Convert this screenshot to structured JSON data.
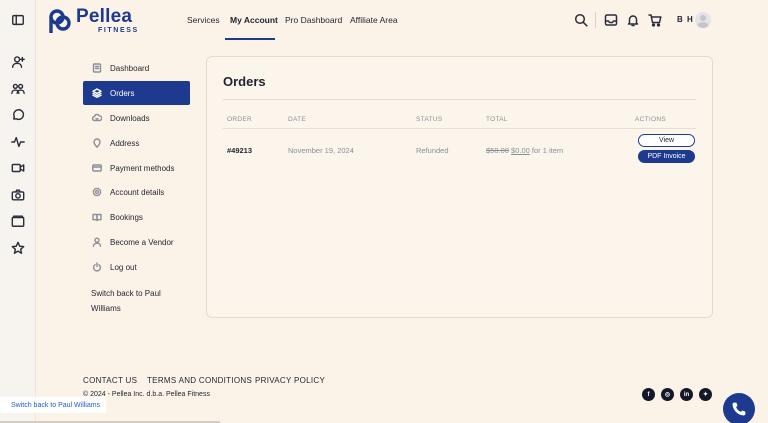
{
  "brand": {
    "name": "Pellea",
    "sub": "FITNESS",
    "color": "#1d3a8f"
  },
  "rail_icons": [
    "sidebar-toggle-icon",
    "user-add-icon",
    "users-icon",
    "chat-icon",
    "activity-icon",
    "video-icon",
    "camera-icon",
    "folder-icon",
    "star-icon"
  ],
  "nav": {
    "services": "Services",
    "my_account": "My Account",
    "pro_dashboard": "Pro Dashboard",
    "affiliate_area": "Affiliate Area"
  },
  "user": {
    "initials": "B H"
  },
  "sidebar": {
    "items": [
      {
        "label": "Dashboard",
        "icon": "dashboard-icon"
      },
      {
        "label": "Orders",
        "icon": "layers-icon"
      },
      {
        "label": "Downloads",
        "icon": "cloud-download-icon"
      },
      {
        "label": "Address",
        "icon": "location-pin-icon"
      },
      {
        "label": "Payment methods",
        "icon": "credit-card-icon"
      },
      {
        "label": "Account details",
        "icon": "settings-icon"
      },
      {
        "label": "Bookings",
        "icon": "book-icon"
      },
      {
        "label": "Become a Vendor",
        "icon": "person-icon"
      },
      {
        "label": "Log out",
        "icon": "power-icon"
      }
    ],
    "switch_back": "Switch back to Paul Williams"
  },
  "orders": {
    "title": "Orders",
    "columns": {
      "order": "ORDER",
      "date": "DATE",
      "status": "STATUS",
      "total": "TOTAL",
      "actions": "ACTIONS"
    },
    "rows": [
      {
        "order": "#49213",
        "date": "November 19, 2024",
        "status": "Refunded",
        "total_old": "$50.00",
        "total_new": "$0.00",
        "total_suffix": "for 1 item",
        "view_label": "View",
        "pdf_label": "PDF Invoice"
      }
    ]
  },
  "footer": {
    "contact": "CONTACT US",
    "terms": "TERMS AND CONDITIONS",
    "privacy": "PRIVACY POLICY",
    "copyright": "© 2024 - Pellea Inc. d.b.a. Pellea Fitness"
  },
  "social_icons": [
    "facebook-icon",
    "instagram-icon",
    "linkedin-icon",
    "twitter-icon"
  ],
  "switch_bar": "Switch back to Paul Williams"
}
